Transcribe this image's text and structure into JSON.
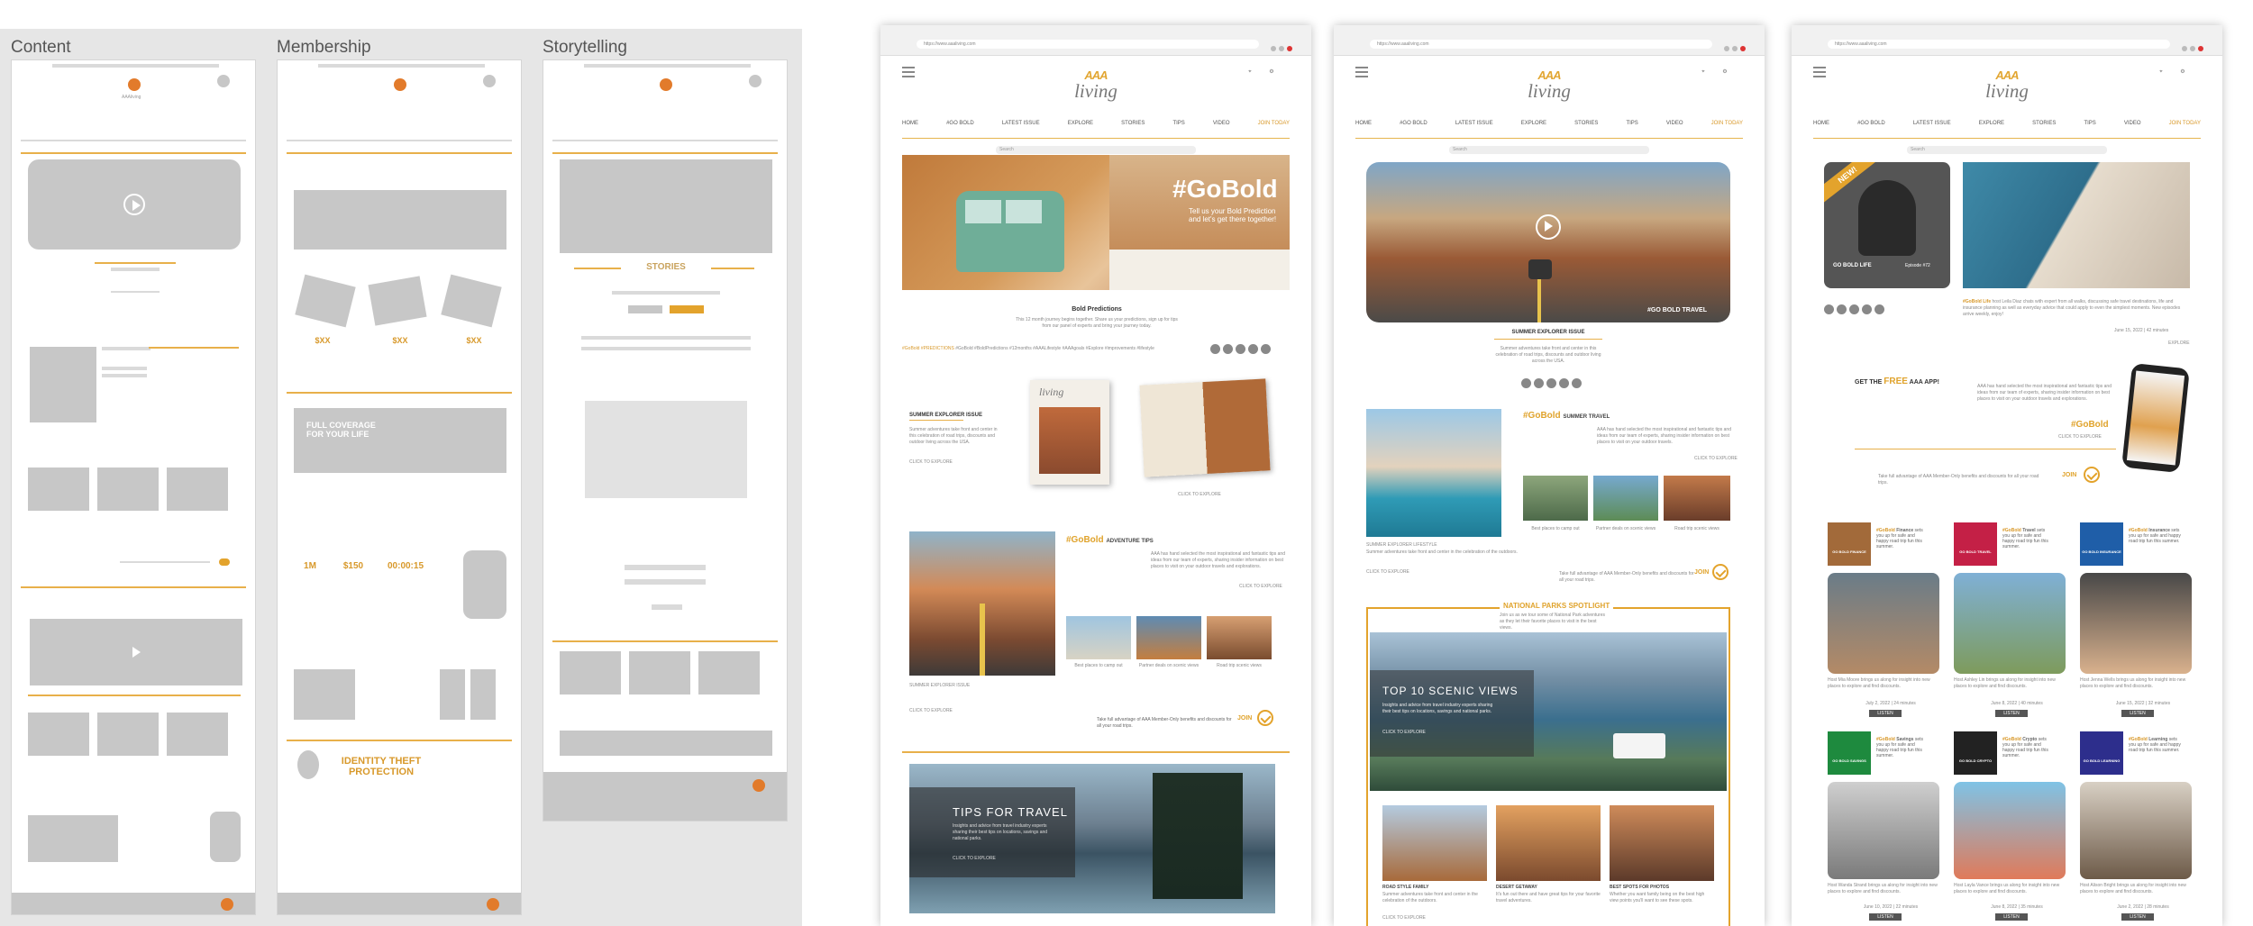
{
  "wireframes": {
    "columns": [
      {
        "title": "Content"
      },
      {
        "title": "Membership"
      },
      {
        "title": "Storytelling"
      }
    ],
    "membership": {
      "prices": [
        "$XX",
        "$XX",
        "$XX"
      ],
      "full_coverage": "FULL COVERAGE FOR YOUR LIFE",
      "stats": [
        "1M",
        "$150",
        "00:00:15"
      ],
      "identity_theft": "IDENTITY THEFT PROTECTION"
    },
    "storytelling": {
      "stories": "STORIES"
    }
  },
  "brand": {
    "logo_mark": "AAA",
    "logo_word": "living",
    "accent": "#e3a32c",
    "orange_dot": "#e27b2b"
  },
  "nav_items": [
    "HOME",
    "#GO BOLD",
    "LATEST ISSUE",
    "EXPLORE",
    "STORIES",
    "TIPS",
    "VIDEO",
    "JOIN TODAY"
  ],
  "site1": {
    "hero_title": "#GoBold",
    "hero_sub": "Tell us your Bold Prediction and let's get there together!",
    "bold_title": "Bold Predictions",
    "bold_body": "This 12 month journey begins together. Share us your predictions, sign up for tips from our panel of experts and bring your journey today.",
    "hashtags_lead": "#GoBold #PREDICTIONS",
    "hashtags_rest": "#GoBold #BoldPredictions #12months #AAALifestyle #AAAgoals #Explore #improvements #lifestyle",
    "summer_issue": "SUMMER EXPLORER ISSUE",
    "summer_issue_body": "Summer adventures take front and center in this celebration of road trips, discounts and outdoor living across the USA.",
    "click_to_explore": "CLICK TO EXPLORE",
    "adventure_heading_bold": "#GoBold",
    "adventure_heading": "ADVENTURE TIPS",
    "adventure_body": "AAA has hand selected the most inspirational and fantastic tips and ideas from our team of experts, sharing insider information on best places to visit on your outdoor travels and explorations.",
    "thumb_caps": [
      "Best places to camp out",
      "Partner deals on scenic views",
      "Road trip scenic views"
    ],
    "join_copy": "Take full advantage of AAA Member-Only benefits and discounts for all your road trips.",
    "join": "JOIN",
    "tips_title": "TIPS FOR TRAVEL",
    "tips_body": "Insights and advice from travel industry experts sharing their best tips on locations, savings and national parks."
  },
  "site2": {
    "summer_issue": "SUMMER EXPLORER ISSUE",
    "summer_body": "Summer adventures take front and center in this celebration of road trips, discounts and outdoor living across the USA.",
    "travel_heading_bold": "#GoBold",
    "travel_heading": "SUMMER TRAVEL",
    "travel_body": "AAA has hand selected the most inspirational and fantastic tips and ideas from our team of experts, sharing insider information on best places to visit on your outdoor travels.",
    "lifestyle": "SUMMER EXPLORER LIFESTYLE",
    "lifestyle_body": "Summer adventures take front and center in the celebration of the outdoors.",
    "click_to_explore": "CLICK TO EXPLORE",
    "thumb_caps": [
      "Best places to camp out",
      "Partner deals on scenic views",
      "Road trip scenic views"
    ],
    "go_bold_travel": "#GO BOLD TRAVEL",
    "join_copy": "Take full advantage of AAA Member-Only benefits and discounts for all your road trips.",
    "join": "JOIN",
    "parks": "NATIONAL PARKS SPOTLIGHT",
    "parks_body": "Join us as we tour some of National Park adventures as they let their favorite places to visit in the best views.",
    "scenic_title": "TOP 10 SCENIC VIEWS",
    "scenic_body": "Insights and advice from travel industry experts sharing their best tips on locations, savings and national parks.",
    "cards": [
      {
        "title": "ROAD STYLE FAMILY",
        "body": "Summer adventures take front and center in the celebration of the outdoors."
      },
      {
        "title": "DESERT GETAWAY",
        "body": "It's fun out there and have great tips for your favorite travel adventures."
      },
      {
        "title": "BEST SPOTS FOR PHOTOS",
        "body": "Whether you want family being on the best high view points you'll want to see these spots."
      }
    ]
  },
  "site3": {
    "new_badge": "NEW!",
    "podcast_label": "GO BOLD LIFE",
    "episode": "Episode #72",
    "feature_body_bold": "#GoBold Life",
    "feature_body": "host Leila Diaz chats with expert from all walks, discussing safe travel destinations, life and insurance planning as well as everyday advice that could apply to even the simplest moments. New episodes arrive weekly, enjoy!",
    "feature_date": "June 15, 2022 | 42 minutes",
    "explore": "EXPLORE",
    "app_get": "GET THE",
    "app_free": "FREE",
    "app_name": "AAA APP!",
    "app_body": "AAA has hand selected the most inspirational and fantastic tips and ideas from our team of experts, sharing insider information on best places to visit on your outdoor travels and explorations.",
    "app_tag": "#GoBold",
    "app_click": "CLICK TO EXPLORE",
    "join_copy": "Take full advantage of AAA Member-Only benefits and discounts for all your road trips.",
    "join": "JOIN",
    "podcasts": [
      {
        "tile": "GO BOLD FINANCE",
        "bold": "#GoBold",
        "topic": "Finance",
        "body": "sets you up for safe and happy road trip fun this summer.",
        "host": "Host Mia Moore brings us along for insight into new places to explore and find discounts.",
        "date": "July 2, 2022 | 24 minutes"
      },
      {
        "tile": "GO BOLD TRAVEL",
        "bold": "#GoBold",
        "topic": "Travel",
        "body": "sets you up for safe and happy road trip fun this summer.",
        "host": "Host Ashley Lin brings us along for insight into new places to explore and find discounts.",
        "date": "June 8, 2022 | 40 minutes"
      },
      {
        "tile": "GO BOLD INSURANCE",
        "bold": "#GoBold",
        "topic": "Insurance",
        "body": "sets you up for safe and happy road trip fun this summer.",
        "host": "Host Jenna Wells brings us along for insight into new places to explore and find discounts.",
        "date": "June 15, 2022 | 32 minutes"
      },
      {
        "tile": "GO BOLD SAVINGS",
        "bold": "#GoBold",
        "topic": "Savings",
        "body": "sets you up for safe and happy road trip fun this summer.",
        "host": "Host Wanda Strand brings us along for insight into new places to explore and find discounts.",
        "date": "June 10, 2022 | 22 minutes"
      },
      {
        "tile": "GO BOLD CRYPTO",
        "bold": "#GoBold",
        "topic": "Crypto",
        "body": "sets you up for safe and happy road trip fun this summer.",
        "host": "Host Layla Vance brings us along for insight into new places to explore and find discounts.",
        "date": "June 8, 2022 | 35 minutes"
      },
      {
        "tile": "GO BOLD LEARNING",
        "bold": "#GoBold",
        "topic": "Learning",
        "body": "sets you up for safe and happy road trip fun this summer.",
        "host": "Host Alison Bright brings us along for insight into new places to explore and find discounts.",
        "date": "June 2, 2022 | 28 minutes"
      }
    ],
    "listen": "LISTEN"
  }
}
